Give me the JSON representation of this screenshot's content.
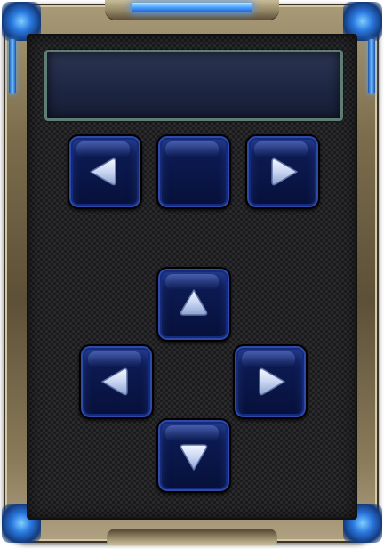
{
  "display": {
    "text": ""
  },
  "top_row": {
    "prev_icon": "triangle-left-icon",
    "center_icon": "blank",
    "next_icon": "triangle-right-icon"
  },
  "dpad": {
    "up_icon": "triangle-up-icon",
    "left_icon": "triangle-left-icon",
    "right_icon": "triangle-right-icon",
    "down_icon": "triangle-down-icon"
  },
  "colors": {
    "frame_gold": "#8a7b5a",
    "glow_blue": "#4ea6ff",
    "button_blue": "#0a1749",
    "arrow_silver": "#c9d6f2",
    "display_bezel": "#5f7d74"
  }
}
